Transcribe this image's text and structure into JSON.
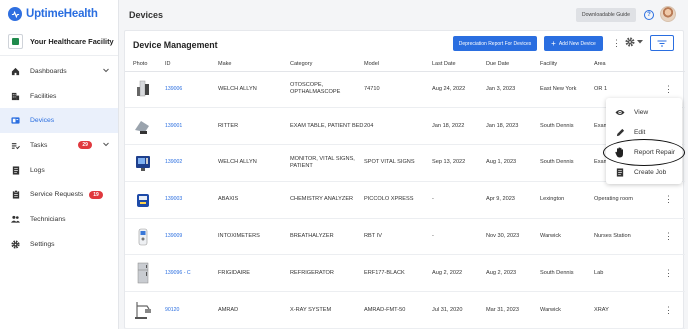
{
  "brand": {
    "name": "UptimeHealth"
  },
  "facility": {
    "name": "Your Healthcare Facility"
  },
  "sidebar": {
    "items": [
      {
        "label": "Dashboards",
        "icon": "home-icon",
        "chevron": true
      },
      {
        "label": "Facilities",
        "icon": "building-icon"
      },
      {
        "label": "Devices",
        "icon": "devices-icon",
        "active": true
      },
      {
        "label": "Tasks",
        "icon": "tasks-icon",
        "badge": "29",
        "chevron": true
      },
      {
        "label": "Logs",
        "icon": "logs-icon"
      },
      {
        "label": "Service Requests",
        "icon": "clipboard-icon",
        "badge": "19"
      },
      {
        "label": "Technicians",
        "icon": "people-icon"
      },
      {
        "label": "Settings",
        "icon": "gear-icon"
      }
    ]
  },
  "topbar": {
    "title": "Devices",
    "guide_label": "Downloadable Guide"
  },
  "main": {
    "title": "Device Management",
    "depreciation_label": "Depreciation Report For Devices",
    "add_label": "Add New Device"
  },
  "table": {
    "headers": [
      "Photo",
      "ID",
      "Make",
      "Category",
      "Model",
      "Last Date",
      "Due Date",
      "Facility",
      "Area"
    ],
    "rows": [
      {
        "thumb": "otoscope",
        "id": "139006",
        "make": "WELCH ALLYN",
        "category": "OTOSCOPE, OPTHALMASCOPE",
        "model": "74710",
        "last": "Aug 24, 2022",
        "due": "Jan 3, 2023",
        "facility": "East New York",
        "area": "OR 1"
      },
      {
        "thumb": "exam-table",
        "id": "139001",
        "make": "RITTER",
        "category": "EXAM TABLE, PATIENT BED",
        "model": "204",
        "last": "Jan 18, 2022",
        "due": "Jan 18, 2023",
        "facility": "South Dennis",
        "area": "Exam"
      },
      {
        "thumb": "monitor",
        "id": "139002",
        "make": "WELCH ALLYN",
        "category": "MONITOR, VITAL SIGNS, PATIENT",
        "model": "SPOT VITAL SIGNS",
        "last": "Sep 13, 2022",
        "due": "Aug 1, 2023",
        "facility": "South Dennis",
        "area": "Exam"
      },
      {
        "thumb": "analyzer",
        "id": "139003",
        "make": "ABAXIS",
        "category": "CHEMISTRY ANALYZER",
        "model": "PICCOLO XPRESS",
        "last": "-",
        "due": "Apr 9, 2023",
        "facility": "Lexington",
        "area": "Operating room"
      },
      {
        "thumb": "breathalyzer",
        "id": "139009",
        "make": "INTOXIMETERS",
        "category": "BREATHALYZER",
        "model": "RBT IV",
        "last": "-",
        "due": "Nov 30, 2023",
        "facility": "Warwick",
        "area": "Nurses Station"
      },
      {
        "thumb": "fridge",
        "id": "139096 - C",
        "make": "FRIGIDAIRE",
        "category": "REFRIGERATOR",
        "model": "ERF177-BLACK",
        "last": "Aug 2, 2022",
        "due": "Aug 2, 2023",
        "facility": "South Dennis",
        "area": "Lab"
      },
      {
        "thumb": "xray",
        "id": "90120",
        "make": "AMRAD",
        "category": "X-RAY SYSTEM",
        "model": "AMRAD-FMT-50",
        "last": "Jul 31, 2020",
        "due": "Mar 31, 2023",
        "facility": "Warwick",
        "area": "XRAY"
      }
    ]
  },
  "menu": {
    "items": [
      {
        "label": "View",
        "icon": "eye-icon"
      },
      {
        "label": "Edit",
        "icon": "pencil-icon"
      },
      {
        "label": "Report Repair",
        "icon": "hand-icon"
      },
      {
        "label": "Create Job",
        "icon": "job-icon"
      }
    ]
  },
  "colors": {
    "accent": "#2a6ee0",
    "badge": "#e0393e",
    "active_bg": "#eaf0fb"
  }
}
